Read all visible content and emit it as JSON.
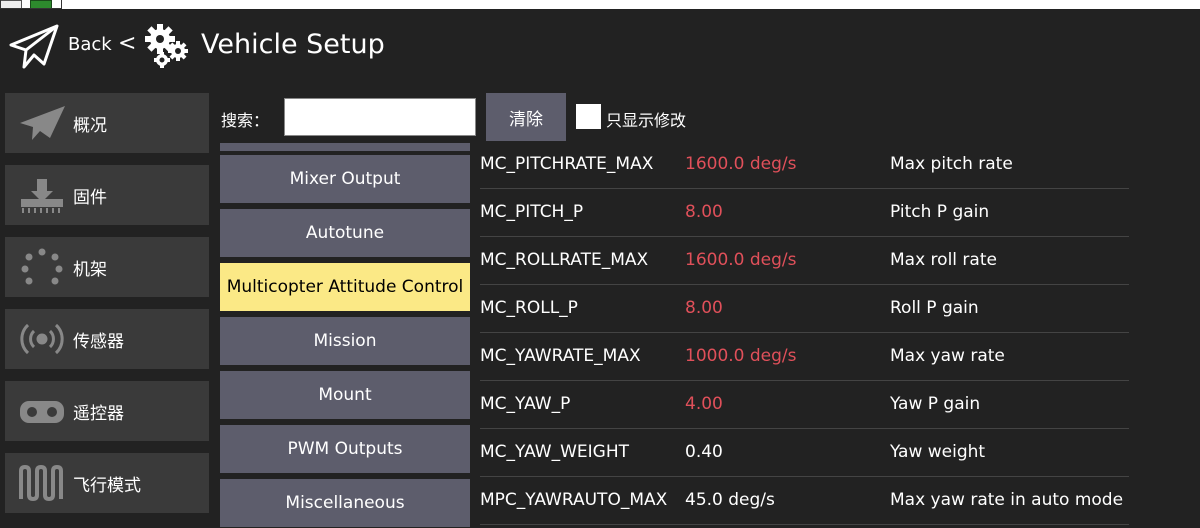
{
  "header": {
    "back_label": "Back",
    "separator": "<",
    "title": "Vehicle Setup"
  },
  "sidebar": {
    "items": [
      {
        "label": "概况",
        "icon": "plane-icon"
      },
      {
        "label": "固件",
        "icon": "download-icon"
      },
      {
        "label": "机架",
        "icon": "airframe-icon"
      },
      {
        "label": "传感器",
        "icon": "sensors-icon"
      },
      {
        "label": "遥控器",
        "icon": "radio-icon"
      },
      {
        "label": "飞行模式",
        "icon": "flight-modes-icon"
      }
    ]
  },
  "search": {
    "label": "搜索：",
    "value": "",
    "clear_label": "清除",
    "modified_only_label": "只显示修改",
    "modified_only_checked": false
  },
  "groups": {
    "items": [
      {
        "label": "Mixer Output",
        "selected": false
      },
      {
        "label": "Autotune",
        "selected": false
      },
      {
        "label": "Multicopter Attitude Control",
        "selected": true
      },
      {
        "label": "Mission",
        "selected": false
      },
      {
        "label": "Mount",
        "selected": false
      },
      {
        "label": "PWM Outputs",
        "selected": false
      },
      {
        "label": "Miscellaneous",
        "selected": false
      }
    ]
  },
  "params": {
    "rows": [
      {
        "name": "MC_PITCHRATE_MAX",
        "value": "1600.0 deg/s",
        "description": "Max pitch rate",
        "modified": true
      },
      {
        "name": "MC_PITCH_P",
        "value": "8.00",
        "description": "Pitch P gain",
        "modified": true
      },
      {
        "name": "MC_ROLLRATE_MAX",
        "value": "1600.0 deg/s",
        "description": "Max roll rate",
        "modified": true
      },
      {
        "name": "MC_ROLL_P",
        "value": "8.00",
        "description": "Roll P gain",
        "modified": true
      },
      {
        "name": "MC_YAWRATE_MAX",
        "value": "1000.0 deg/s",
        "description": "Max yaw rate",
        "modified": true
      },
      {
        "name": "MC_YAW_P",
        "value": "4.00",
        "description": "Yaw P gain",
        "modified": true
      },
      {
        "name": "MC_YAW_WEIGHT",
        "value": "0.40",
        "description": "Yaw weight",
        "modified": false
      },
      {
        "name": "MPC_YAWRAUTO_MAX",
        "value": "45.0 deg/s",
        "description": "Max yaw rate in auto mode",
        "modified": false
      }
    ]
  },
  "colors": {
    "background": "#222222",
    "button": "#5d5d6c",
    "selected": "#fbe986",
    "modified_value": "#e0505a",
    "default_value": "#ffffff"
  }
}
